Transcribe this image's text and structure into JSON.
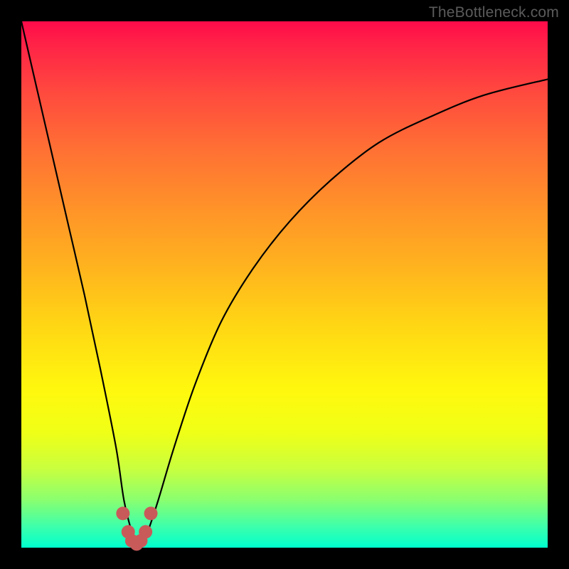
{
  "watermark": "TheBottleneck.com",
  "chart_data": {
    "type": "line",
    "title": "",
    "xlabel": "",
    "ylabel": "",
    "xlim": [
      0,
      100
    ],
    "ylim": [
      0,
      100
    ],
    "grid": false,
    "series": [
      {
        "name": "bottleneck-curve",
        "x": [
          0,
          3,
          6,
          9,
          12,
          15,
          18,
          19.5,
          21,
          22,
          23,
          24,
          26,
          29,
          33,
          38,
          44,
          51,
          59,
          68,
          78,
          88,
          100
        ],
        "y": [
          100,
          87,
          74,
          61,
          48,
          34,
          19,
          9,
          3,
          1,
          1,
          3,
          9,
          19,
          31,
          43,
          53,
          62,
          70,
          77,
          82,
          86,
          89
        ]
      }
    ],
    "markers": {
      "name": "highlight",
      "color": "#c95a5a",
      "x": [
        19.3,
        20.3,
        21.0,
        21.9,
        22.7,
        23.6,
        24.6
      ],
      "y": [
        6.5,
        3.0,
        1.3,
        0.7,
        1.3,
        3.0,
        6.5
      ]
    },
    "background_gradient": {
      "top": "#ff0a4a",
      "bottom": "#00ffcd"
    }
  }
}
